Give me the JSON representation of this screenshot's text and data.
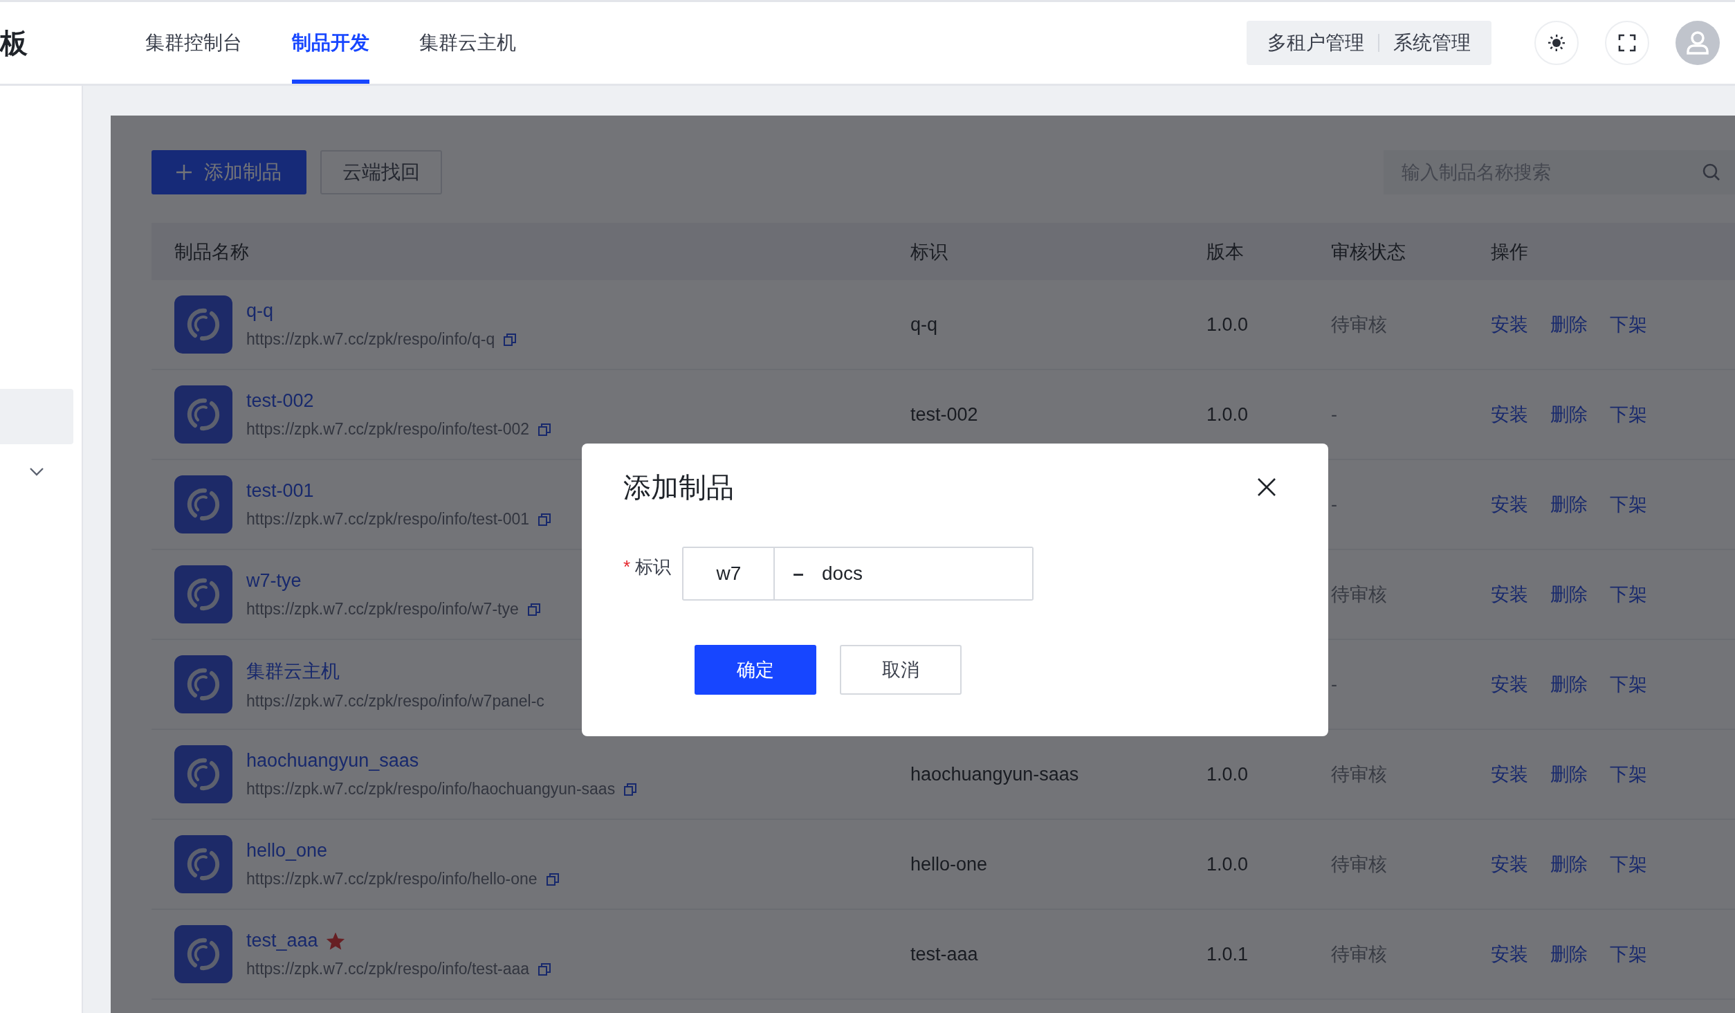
{
  "header": {
    "logo_text": "板",
    "tabs": [
      {
        "label": "集群控制台",
        "selected": false
      },
      {
        "label": "制品开发",
        "selected": true
      },
      {
        "label": "集群云主机",
        "selected": false
      }
    ],
    "admin_links": [
      "多租户管理",
      "系统管理"
    ]
  },
  "sidebar": {
    "items": [
      {
        "selected": true
      },
      {
        "selected": false,
        "expanded": false
      }
    ]
  },
  "toolbar": {
    "add_button": "添加制品",
    "recover_button": "云端找回",
    "search": {
      "placeholder": "输入制品名称搜索"
    }
  },
  "table": {
    "columns": [
      "制品名称",
      "标识",
      "版本",
      "审核状态",
      "操作"
    ],
    "rows": [
      {
        "name": "q-q",
        "url": "https://zpk.w7.cc/zpk/respo/info/q-q",
        "copy": true,
        "starred": false,
        "identifier": "q-q",
        "version": "1.0.0",
        "status": "待审核",
        "actions": [
          "安装",
          "删除",
          "下架"
        ]
      },
      {
        "name": "test-002",
        "url": "https://zpk.w7.cc/zpk/respo/info/test-002",
        "copy": true,
        "starred": false,
        "identifier": "test-002",
        "version": "1.0.0",
        "status": "-",
        "actions": [
          "安装",
          "删除",
          "下架"
        ]
      },
      {
        "name": "test-001",
        "url": "https://zpk.w7.cc/zpk/respo/info/test-001",
        "copy": true,
        "starred": false,
        "status": "-",
        "actions": [
          "安装",
          "删除",
          "下架"
        ]
      },
      {
        "name": "w7-tye",
        "url": "https://zpk.w7.cc/zpk/respo/info/w7-tye",
        "copy": true,
        "starred": false,
        "status": "待审核",
        "actions": [
          "安装",
          "删除",
          "下架"
        ]
      },
      {
        "name": "集群云主机",
        "url": "https://zpk.w7.cc/zpk/respo/info/w7panel-c",
        "copy": false,
        "starred": false,
        "status": "-",
        "actions": [
          "安装",
          "删除",
          "下架"
        ]
      },
      {
        "name": "haochuangyun_saas",
        "url": "https://zpk.w7.cc/zpk/respo/info/haochuangyun-saas",
        "copy": true,
        "starred": false,
        "identifier": "haochuangyun-saas",
        "version": "1.0.0",
        "status": "待审核",
        "actions": [
          "安装",
          "删除",
          "下架"
        ]
      },
      {
        "name": "hello_one",
        "url": "https://zpk.w7.cc/zpk/respo/info/hello-one",
        "copy": true,
        "starred": false,
        "identifier": "hello-one",
        "version": "1.0.0",
        "status": "待审核",
        "actions": [
          "安装",
          "删除",
          "下架"
        ]
      },
      {
        "name": "test_aaa",
        "url": "https://zpk.w7.cc/zpk/respo/info/test-aaa",
        "copy": true,
        "starred": true,
        "identifier": "test-aaa",
        "version": "1.0.1",
        "status": "待审核",
        "actions": [
          "安装",
          "删除",
          "下架"
        ]
      }
    ]
  },
  "modal": {
    "title": "添加制品",
    "field": {
      "label": "标识",
      "required_mark": "*",
      "prefix": "w7",
      "separator": "–",
      "value": "docs"
    },
    "buttons": [
      {
        "label": "确定",
        "kind": "primary"
      },
      {
        "label": "取消",
        "kind": "default"
      }
    ]
  }
}
